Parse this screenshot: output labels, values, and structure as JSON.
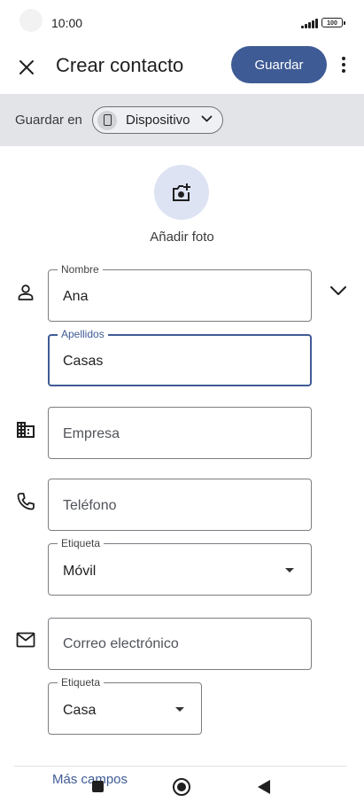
{
  "status_bar": {
    "time": "10:00",
    "battery": "100"
  },
  "app_bar": {
    "title": "Crear contacto",
    "save_label": "Guardar",
    "close_icon": "close-icon",
    "more_icon": "more-vert-icon"
  },
  "save_in": {
    "label": "Guardar en",
    "account": "Dispositivo",
    "account_icon": "phone-icon"
  },
  "photo": {
    "label": "Añadir foto",
    "icon": "add-photo-icon"
  },
  "fields": {
    "first_name": {
      "label": "Nombre",
      "value": "Ana"
    },
    "last_name": {
      "label": "Apellidos",
      "value": "Casas"
    },
    "company": {
      "placeholder": "Empresa"
    },
    "phone": {
      "placeholder": "Teléfono"
    },
    "phone_label": {
      "label": "Etiqueta",
      "value": "Móvil"
    },
    "email": {
      "placeholder": "Correo electrónico"
    },
    "email_label": {
      "label": "Etiqueta",
      "value": "Casa"
    }
  },
  "more_fields": "Más campos",
  "colors": {
    "accent": "#3f5b95",
    "save_bar_bg": "#e3e4e8",
    "photo_circle": "#dde3f3"
  }
}
